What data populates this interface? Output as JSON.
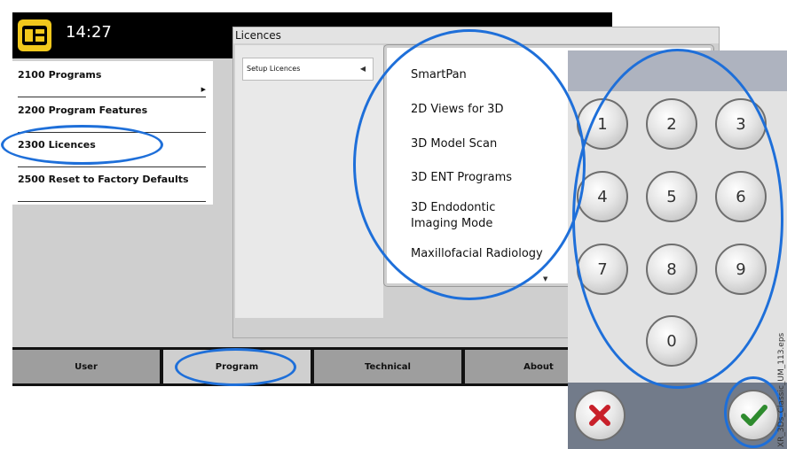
{
  "top_bar": {
    "time": "14:27",
    "logo_icon": "device-icon",
    "logo_color": "#f2c81c"
  },
  "menu": {
    "items": [
      {
        "num": "2100",
        "label": "Programs",
        "has_submenu": true
      },
      {
        "num": "2200",
        "label": "Program Features"
      },
      {
        "num": "2300",
        "label": "Licences"
      },
      {
        "num": "2500",
        "label": "Reset to Factory Defaults"
      }
    ]
  },
  "tabs": [
    {
      "label": "User"
    },
    {
      "label": "Program",
      "selected": true
    },
    {
      "label": "Technical"
    },
    {
      "label": "About"
    }
  ],
  "licences_window": {
    "title": "Licences",
    "setup_label": "Setup Licences",
    "items": [
      {
        "label": "SmartPan"
      },
      {
        "label": "2D Views for 3D"
      },
      {
        "label": "3D Model Scan"
      },
      {
        "label": "3D ENT Programs"
      },
      {
        "label": "3D Endodontic Imaging Mode"
      },
      {
        "label": "Maxillofacial Radiology"
      }
    ]
  },
  "keypad": {
    "keys": [
      "1",
      "2",
      "3",
      "4",
      "5",
      "6",
      "7",
      "8",
      "9",
      "0"
    ],
    "cancel_icon": "x-icon",
    "confirm_icon": "checkmark-icon",
    "cancel_color": "#c8202a",
    "confirm_color": "#2e8b2e"
  },
  "highlight_color": "#1e6fd9",
  "side_caption": "XR_3Ds_Classic_UM_113.eps"
}
